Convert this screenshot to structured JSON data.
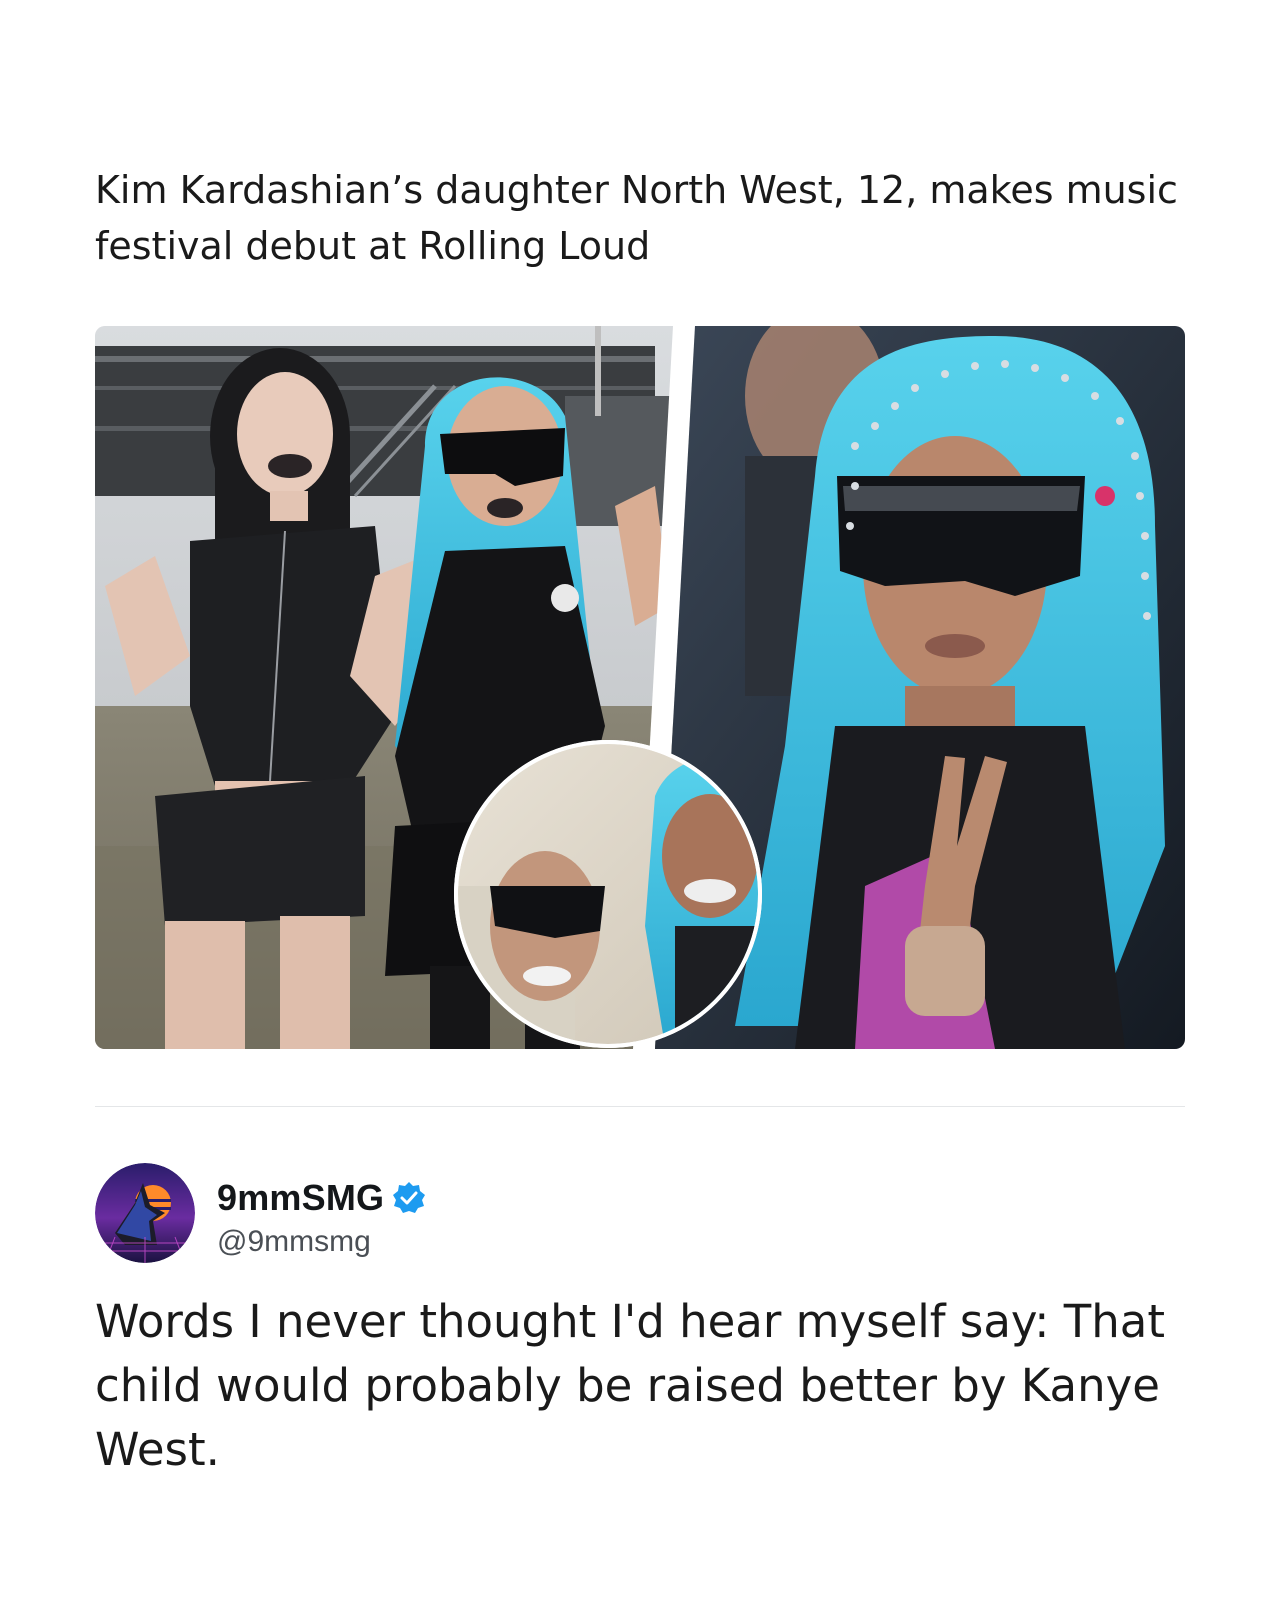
{
  "headline": "Kim Kardashian’s daughter North West, 12, makes music festival debut at Rolling Loud",
  "tweet": {
    "author_name": "9mmSMG",
    "author_handle": "@9mmsmg",
    "verified": true,
    "text": "Words I never thought I'd hear myself say: That child would probably be raised better by Kanye West."
  },
  "colors": {
    "accent_blue": "#1d9bf0",
    "hair_blue": "#3cc6e6",
    "text": "#1a1a1a"
  },
  "icons": {
    "verified": "verified-badge-icon",
    "avatar": "jackal-avatar-icon"
  }
}
